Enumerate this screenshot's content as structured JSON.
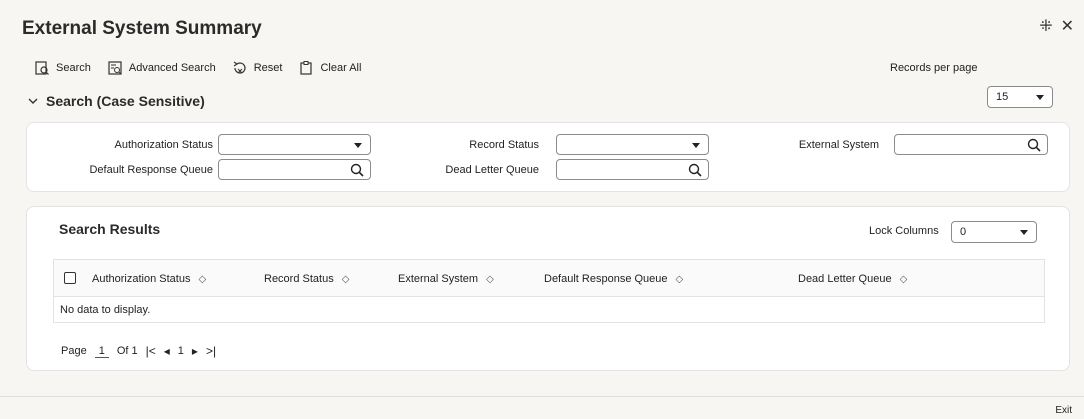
{
  "header": {
    "title": "External System Summary",
    "controls": [
      "expand-icon",
      "close-icon"
    ]
  },
  "toolbar": {
    "search": "Search",
    "advanced_search": "Advanced Search",
    "reset": "Reset",
    "clear_all": "Clear All"
  },
  "records_per_page": {
    "label": "Records per page",
    "value": "15"
  },
  "criteria": {
    "section_title": "Search (Case Sensitive)",
    "authorization_status": {
      "label": "Authorization Status",
      "value": ""
    },
    "record_status": {
      "label": "Record Status",
      "value": ""
    },
    "external_system": {
      "label": "External System",
      "value": ""
    },
    "default_response_queue": {
      "label": "Default Response Queue",
      "value": ""
    },
    "dead_letter_queue": {
      "label": "Dead Letter Queue",
      "value": ""
    }
  },
  "results": {
    "title": "Search Results",
    "lock_columns": {
      "label": "Lock Columns",
      "value": "0"
    },
    "columns": [
      "Authorization Status",
      "Record Status",
      "External System",
      "Default Response Queue",
      "Dead Letter Queue"
    ],
    "empty_message": "No data to display.",
    "pager": {
      "page_label": "Page",
      "page": "1",
      "of_label": "Of 1",
      "first": "|<",
      "prev": "◂",
      "current": "1",
      "next": "▸",
      "last": ">|"
    }
  },
  "footer": {
    "exit": "Exit"
  }
}
